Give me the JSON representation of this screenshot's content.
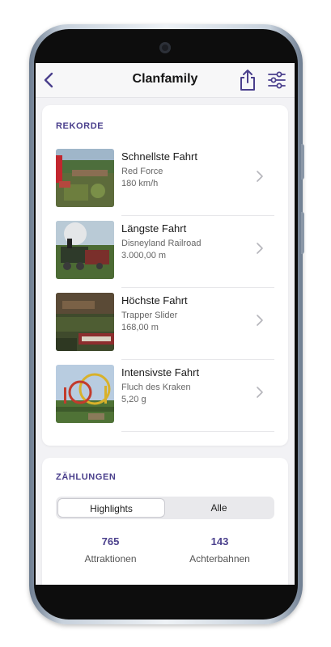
{
  "header": {
    "title": "Clanfamily",
    "back_icon": "chevron-left-icon",
    "share_icon": "share-icon",
    "filter_icon": "sliders-icon",
    "accent_color": "#4a3f8c"
  },
  "rekorde": {
    "title": "REKORDE",
    "items": [
      {
        "title": "Schnellste Fahrt",
        "subtitle": "Red Force",
        "value": "180 km/h"
      },
      {
        "title": "Längste Fahrt",
        "subtitle": "Disneyland Railroad",
        "value": "3.000,00 m"
      },
      {
        "title": "Höchste Fahrt",
        "subtitle": "Trapper Slider",
        "value": "168,00 m"
      },
      {
        "title": "Intensivste Fahrt",
        "subtitle": "Fluch des Kraken",
        "value": "5,20 g"
      }
    ]
  },
  "zaehlungen": {
    "title": "ZÄHLUNGEN",
    "tabs": [
      "Highlights",
      "Alle"
    ],
    "selected_tab": "Highlights",
    "counts": [
      {
        "value": "765",
        "label": "Attraktionen"
      },
      {
        "value": "143",
        "label": "Achterbahnen"
      }
    ]
  }
}
